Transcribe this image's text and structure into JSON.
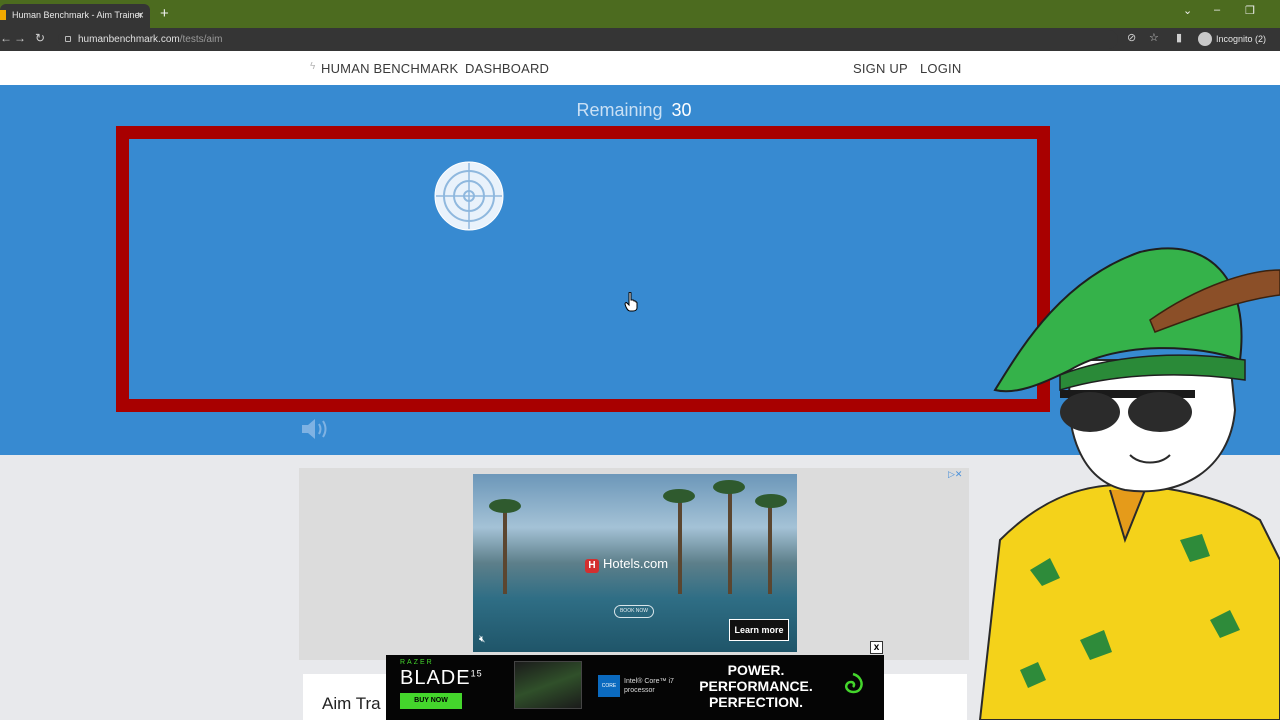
{
  "browser": {
    "tab_title": "Human Benchmark - Aim Trainer",
    "new_tab": "+",
    "url_domain": "humanbenchmark.com",
    "url_path": "/tests/aim",
    "incognito_label": "Incognito (2)"
  },
  "site_nav": {
    "brand": "HUMAN BENCHMARK",
    "dashboard": "DASHBOARD",
    "sign_up": "SIGN UP",
    "login": "LOGIN"
  },
  "game": {
    "remaining_label": "Remaining",
    "remaining_count": "30"
  },
  "ad": {
    "brand": "Hotels.com",
    "brand_mark": "H",
    "book_now": "BOOK NOW",
    "learn_more": "Learn more"
  },
  "card": {
    "title": "Aim Tra"
  },
  "banner": {
    "razer": "RAZER",
    "product": "BLADE",
    "product_sup": "15",
    "buy_now": "BUY NOW",
    "intel_badge": "CORE",
    "intel_text": "Intel® Core™ i7 processor",
    "slogan_1": "POWER.",
    "slogan_2": "PERFORMANCE.",
    "slogan_3": "PERFECTION.",
    "close": "x"
  },
  "colors": {
    "hero_blue": "#378ad1",
    "highlight_red": "#a80000",
    "razer_green": "#44d62c"
  }
}
